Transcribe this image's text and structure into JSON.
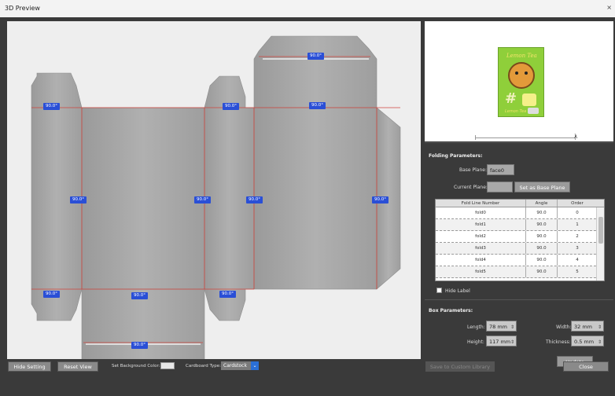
{
  "window": {
    "title": "3D Preview",
    "close": "×"
  },
  "dieline": {
    "labels": [
      "90.0°",
      "90.0°",
      "90.0°",
      "90.0°",
      "90.0°",
      "90.0°",
      "90.0°",
      "90.0°",
      "90.0°",
      "90.0°",
      "90.0°",
      "90.0°"
    ]
  },
  "preview": {
    "card_title": "Lemon Tea",
    "card_sub": "Lemon Tea",
    "slider_end": "λ"
  },
  "folding": {
    "title": "Folding Parameters:",
    "base_plane_label": "Base Plane:",
    "base_plane_value": "face0",
    "current_plane_label": "Current Plane:",
    "current_plane_value": "",
    "set_base_button": "Set as Base Plane",
    "columns": [
      "Fold Line Number",
      "Angle",
      "Order"
    ],
    "rows": [
      [
        "fold0",
        "90.0",
        "0"
      ],
      [
        "fold1",
        "90.0",
        "1"
      ],
      [
        "fold2",
        "90.0",
        "2"
      ],
      [
        "fold3",
        "90.0",
        "3"
      ],
      [
        "fold4",
        "90.0",
        "4"
      ],
      [
        "fold5",
        "90.0",
        "5"
      ]
    ],
    "hide_label": "Hide Label"
  },
  "box": {
    "title": "Box Parameters:",
    "length_label": "Length:",
    "length_value": "78 mm",
    "width_label": "Width:",
    "width_value": "32 mm",
    "height_label": "Height:",
    "height_value": "117 mm",
    "thickness_label": "Thickness:",
    "thickness_value": "0.5 mm",
    "update_button": "Update"
  },
  "bottom": {
    "hide_setting": "Hide Setting",
    "reset_view": "Reset View",
    "bg_color_label": "Set Background Color:",
    "cardboard_label": "Cardboard Type:",
    "cardboard_value": "Cardstock",
    "save_custom": "Save to Custom Library",
    "close": "Close"
  },
  "colors": {
    "angle_label": "#2a4fd6",
    "fold_line": "#d0453c",
    "dropdown": "#2a6fd6"
  }
}
